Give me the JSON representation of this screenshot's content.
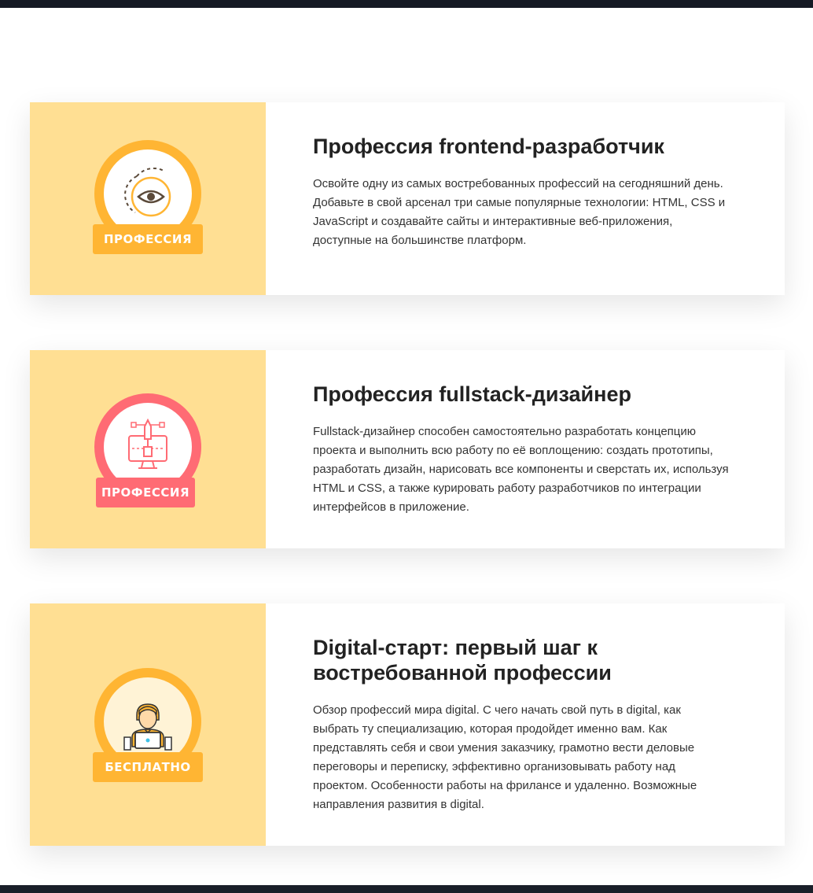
{
  "cards": [
    {
      "badge_label": "ПРОФЕССИЯ",
      "badge_icon": "eye-icon",
      "badge_color": "#ffb533",
      "title": "Профессия frontend-разработчик",
      "description": "Освойте одну из самых востребованных профессий на сегодняшний день. Добавьте в свой арсенал три самые популярные технологии: HTML, CSS и JavaScript и создавайте сайты и интерактивные веб-приложения, доступные на большинстве платформ."
    },
    {
      "badge_label": "ПРОФЕССИЯ",
      "badge_icon": "pen-tool-monitor-icon",
      "badge_color": "#ff6b74",
      "title": "Профессия fullstack-дизайнер",
      "description": "Fullstack-дизайнер способен самостоятельно разработать концепцию проекта и выполнить всю работу по её воплощению: создать прототипы, разработать дизайн, нарисовать все компоненты и сверстать их, используя HTML и CSS, а также курировать работу разработчиков по интеграции интерфейсов в приложение."
    },
    {
      "badge_label": "БЕСПЛАТНО",
      "badge_icon": "person-laptop-icon",
      "badge_color": "#ffb533",
      "title": "Digital-старт: первый шаг к востребованной профессии",
      "description": "Обзор профессий мира digital. С чего начать свой путь в digital, как выбрать ту специализацию, которая продойдет именно вам. Как представлять себя и свои умения заказчику, грамотно вести деловые переговоры и переписку, эффективно организовывать работу над проектом. Особенности работы на фрилансе и удаленно. Возможные направления развития в digital."
    }
  ],
  "colors": {
    "media_background": "#ffdf93",
    "accent_orange": "#ffb533",
    "accent_pink": "#ff6b74",
    "top_bar": "#151a24"
  }
}
